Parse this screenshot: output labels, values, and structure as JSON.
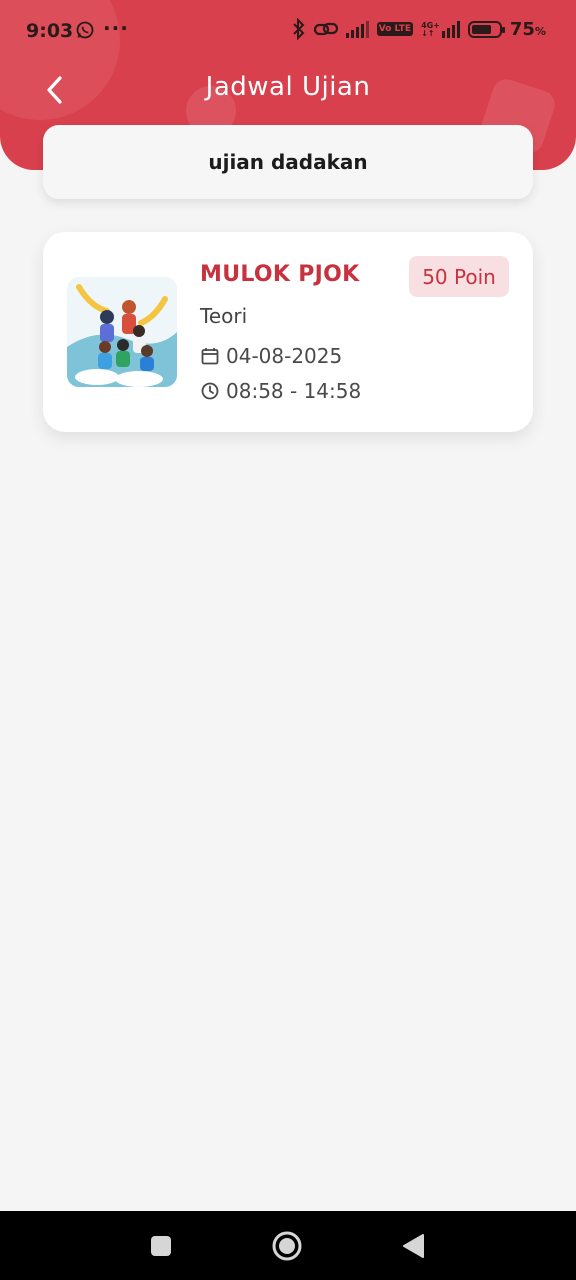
{
  "status_bar": {
    "time": "9:03",
    "more": "···",
    "network_top": "4G+",
    "network_bottom": "↓↑",
    "volte": "Vo LTE",
    "battery_percent": "75",
    "battery_unit": "%",
    "battery_level": 0.75,
    "icons": [
      "whatsapp-icon",
      "bluetooth-icon",
      "link-icon",
      "signal-icon",
      "volte-icon",
      "4g-signal-icon",
      "battery-icon"
    ]
  },
  "app_bar": {
    "title": "Jadwal Ujian",
    "back_icon": "chevron-left-icon"
  },
  "search": {
    "value": "ujian dadakan"
  },
  "exams": [
    {
      "title": "MULOK PJOK",
      "points": "50 Poin",
      "type": "Teori",
      "date": "04-08-2025",
      "time": "08:58 - 14:58",
      "date_icon": "calendar-icon",
      "time_icon": "clock-icon"
    }
  ],
  "nav_bar": {
    "icons": [
      "recents-square-icon",
      "home-circle-icon",
      "back-triangle-icon"
    ]
  },
  "colors": {
    "primary": "#d9404d",
    "accent_text": "#c8323f",
    "badge_bg": "#f8e0e2",
    "background": "#f5f5f5"
  }
}
